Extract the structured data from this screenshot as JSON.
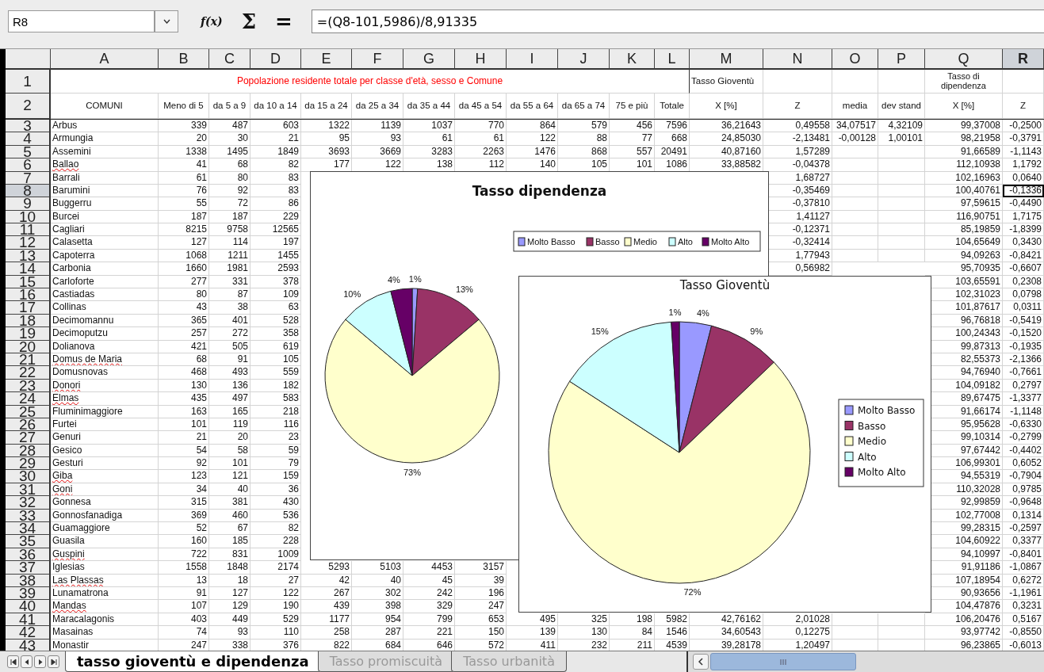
{
  "toolbar": {
    "cell_ref": "R8",
    "buttons": [
      "f(x)",
      "Σ",
      "="
    ],
    "formula": "=(Q8-101,5986)/8,91335"
  },
  "columns": [
    {
      "label": "A",
      "selected": false
    },
    {
      "label": "B",
      "selected": false
    },
    {
      "label": "C",
      "selected": false
    },
    {
      "label": "D",
      "selected": false
    },
    {
      "label": "E",
      "selected": false
    },
    {
      "label": "F",
      "selected": false
    },
    {
      "label": "G",
      "selected": false
    },
    {
      "label": "H",
      "selected": false
    },
    {
      "label": "I",
      "selected": false
    },
    {
      "label": "J",
      "selected": false
    },
    {
      "label": "K",
      "selected": false
    },
    {
      "label": "L",
      "selected": false
    },
    {
      "label": "M",
      "selected": false
    },
    {
      "label": "N",
      "selected": false
    },
    {
      "label": "O",
      "selected": false
    },
    {
      "label": "P",
      "selected": false
    },
    {
      "label": "Q",
      "selected": false
    },
    {
      "label": "R",
      "selected": true
    }
  ],
  "rows": [
    {
      "n": "1",
      "kind": "title",
      "selected": false,
      "flagged": false,
      "cells": [
        "Popolazione residente totale per classe d'età, sesso e Comune",
        "Tasso Gioventù",
        null,
        null,
        null,
        "Tasso di dipendenza",
        null
      ]
    },
    {
      "n": "2",
      "kind": "header",
      "selected": false,
      "flagged": false,
      "cells": [
        "COMUNI",
        "Meno di 5",
        "da 5 a 9",
        "da 10 a 14",
        "da 15 a 24",
        "da 25 a 34",
        "da 35 a 44",
        "da 45 a 54",
        "da 55 a 64",
        "da 65 a 74",
        "75 e più",
        "Totale",
        "X [%]",
        "Z",
        "media",
        "dev stand",
        "X [%]",
        "Z"
      ]
    },
    {
      "n": "3",
      "kind": "data",
      "selected": false,
      "flagged": false,
      "cells": [
        "Arbus",
        "339",
        "487",
        "603",
        "1322",
        "1139",
        "1037",
        "770",
        "864",
        "579",
        "456",
        "7596",
        "36,21643",
        "0,49558",
        "34,07517",
        "4,32109",
        "99,37008",
        "-0,2500"
      ]
    },
    {
      "n": "4",
      "kind": "data",
      "selected": false,
      "flagged": false,
      "cells": [
        "Armungia",
        "20",
        "30",
        "21",
        "95",
        "93",
        "61",
        "61",
        "122",
        "88",
        "77",
        "668",
        "24,85030",
        "-2,13481",
        "-0,00128",
        "1,00101",
        "98,21958",
        "-0,3791"
      ]
    },
    {
      "n": "5",
      "kind": "data",
      "selected": false,
      "flagged": false,
      "cells": [
        "Assemini",
        "1338",
        "1495",
        "1849",
        "3693",
        "3669",
        "3283",
        "2263",
        "1476",
        "868",
        "557",
        "20491",
        "40,87160",
        "1,57289",
        null,
        null,
        "91,66589",
        "-1,1143"
      ]
    },
    {
      "n": "6",
      "kind": "data",
      "selected": false,
      "flagged": true,
      "cells": [
        "Ballao",
        "41",
        "68",
        "82",
        "177",
        "122",
        "138",
        "112",
        "140",
        "105",
        "101",
        "1086",
        "33,88582",
        "-0,04378",
        null,
        null,
        "112,10938",
        "1,1792"
      ]
    },
    {
      "n": "7",
      "kind": "data",
      "selected": false,
      "flagged": false,
      "cells": [
        "Barrali",
        "61",
        "80",
        "83",
        null,
        null,
        null,
        null,
        null,
        null,
        null,
        null,
        null,
        "1,68727",
        null,
        null,
        "102,16963",
        "0,0640"
      ]
    },
    {
      "n": "8",
      "kind": "data",
      "selected": true,
      "flagged": false,
      "cells": [
        "Barumini",
        "76",
        "92",
        "83",
        null,
        null,
        null,
        null,
        null,
        null,
        null,
        null,
        null,
        "-0,35469",
        null,
        null,
        "100,40761",
        "-0,1336"
      ]
    },
    {
      "n": "9",
      "kind": "data",
      "selected": false,
      "flagged": false,
      "cells": [
        "Buggerru",
        "55",
        "72",
        "86",
        null,
        null,
        null,
        null,
        null,
        null,
        null,
        null,
        null,
        "-0,37810",
        null,
        null,
        "97,59615",
        "-0,4490"
      ]
    },
    {
      "n": "10",
      "kind": "data",
      "selected": false,
      "flagged": false,
      "cells": [
        "Burcei",
        "187",
        "187",
        "229",
        null,
        null,
        null,
        null,
        null,
        null,
        null,
        null,
        null,
        "1,41127",
        null,
        null,
        "116,90751",
        "1,7175"
      ]
    },
    {
      "n": "11",
      "kind": "data",
      "selected": false,
      "flagged": false,
      "cells": [
        "Cagliari",
        "8215",
        "9758",
        "12565",
        null,
        null,
        null,
        null,
        null,
        null,
        null,
        null,
        null,
        "-0,12371",
        null,
        null,
        "85,19859",
        "-1,8399"
      ]
    },
    {
      "n": "12",
      "kind": "data",
      "selected": false,
      "flagged": false,
      "cells": [
        "Calasetta",
        "127",
        "114",
        "197",
        null,
        null,
        null,
        null,
        null,
        null,
        null,
        null,
        null,
        "-0,32414",
        null,
        null,
        "104,65649",
        "0,3430"
      ]
    },
    {
      "n": "13",
      "kind": "data",
      "selected": false,
      "flagged": false,
      "cells": [
        "Capoterra",
        "1068",
        "1211",
        "1455",
        null,
        null,
        null,
        null,
        null,
        null,
        null,
        null,
        null,
        "1,77943",
        null,
        null,
        "94,09263",
        "-0,8421"
      ]
    },
    {
      "n": "14",
      "kind": "data",
      "selected": false,
      "flagged": false,
      "cells": [
        "Carbonia",
        "1660",
        "1981",
        "2593",
        null,
        null,
        null,
        null,
        null,
        null,
        null,
        null,
        null,
        "0,56982",
        null,
        null,
        "95,70935",
        "-0,6607"
      ]
    },
    {
      "n": "15",
      "kind": "data",
      "selected": false,
      "flagged": false,
      "cells": [
        "Carloforte",
        "277",
        "331",
        "378",
        null,
        null,
        null,
        null,
        null,
        null,
        null,
        null,
        null,
        null,
        null,
        null,
        "103,65591",
        "0,2308"
      ]
    },
    {
      "n": "16",
      "kind": "data",
      "selected": false,
      "flagged": false,
      "cells": [
        "Castiadas",
        "80",
        "87",
        "109",
        null,
        null,
        null,
        null,
        null,
        null,
        null,
        null,
        null,
        null,
        null,
        null,
        "102,31023",
        "0,0798"
      ]
    },
    {
      "n": "17",
      "kind": "data",
      "selected": false,
      "flagged": false,
      "cells": [
        "Collinas",
        "43",
        "38",
        "63",
        null,
        null,
        null,
        null,
        null,
        null,
        null,
        null,
        null,
        null,
        null,
        null,
        "101,87617",
        "0,0311"
      ]
    },
    {
      "n": "18",
      "kind": "data",
      "selected": false,
      "flagged": false,
      "cells": [
        "Decimomannu",
        "365",
        "401",
        "528",
        null,
        null,
        null,
        null,
        null,
        null,
        null,
        null,
        null,
        null,
        null,
        null,
        "96,76818",
        "-0,5419"
      ]
    },
    {
      "n": "19",
      "kind": "data",
      "selected": false,
      "flagged": false,
      "cells": [
        "Decimoputzu",
        "257",
        "272",
        "358",
        null,
        null,
        null,
        null,
        null,
        null,
        null,
        null,
        null,
        null,
        null,
        null,
        "100,24343",
        "-0,1520"
      ]
    },
    {
      "n": "20",
      "kind": "data",
      "selected": false,
      "flagged": false,
      "cells": [
        "Dolianova",
        "421",
        "505",
        "619",
        null,
        null,
        null,
        null,
        null,
        null,
        null,
        null,
        null,
        null,
        null,
        null,
        "99,87313",
        "-0,1935"
      ]
    },
    {
      "n": "21",
      "kind": "data",
      "selected": false,
      "flagged": true,
      "cells": [
        "Domus de Maria",
        "68",
        "91",
        "105",
        null,
        null,
        null,
        null,
        null,
        null,
        null,
        null,
        null,
        null,
        null,
        null,
        "82,55373",
        "-2,1366"
      ]
    },
    {
      "n": "22",
      "kind": "data",
      "selected": false,
      "flagged": false,
      "cells": [
        "Domusnovas",
        "468",
        "493",
        "559",
        null,
        null,
        null,
        null,
        null,
        null,
        null,
        null,
        null,
        null,
        null,
        null,
        "94,76940",
        "-0,7661"
      ]
    },
    {
      "n": "23",
      "kind": "data",
      "selected": false,
      "flagged": true,
      "cells": [
        "Donori",
        "130",
        "136",
        "182",
        null,
        null,
        null,
        null,
        null,
        null,
        null,
        null,
        null,
        null,
        null,
        null,
        "104,09182",
        "0,2797"
      ]
    },
    {
      "n": "24",
      "kind": "data",
      "selected": false,
      "flagged": true,
      "cells": [
        "Elmas",
        "435",
        "497",
        "583",
        null,
        null,
        null,
        null,
        null,
        null,
        null,
        null,
        null,
        null,
        null,
        null,
        "89,67475",
        "-1,3377"
      ]
    },
    {
      "n": "25",
      "kind": "data",
      "selected": false,
      "flagged": false,
      "cells": [
        "Fluminimaggiore",
        "163",
        "165",
        "218",
        null,
        null,
        null,
        null,
        null,
        null,
        null,
        null,
        null,
        null,
        null,
        null,
        "91,66174",
        "-1,1148"
      ]
    },
    {
      "n": "26",
      "kind": "data",
      "selected": false,
      "flagged": false,
      "cells": [
        "Furtei",
        "101",
        "119",
        "116",
        null,
        null,
        null,
        null,
        null,
        null,
        null,
        null,
        null,
        null,
        null,
        null,
        "95,95628",
        "-0,6330"
      ]
    },
    {
      "n": "27",
      "kind": "data",
      "selected": false,
      "flagged": false,
      "cells": [
        "Genuri",
        "21",
        "20",
        "23",
        null,
        null,
        null,
        null,
        null,
        null,
        null,
        null,
        null,
        null,
        null,
        null,
        "99,10314",
        "-0,2799"
      ]
    },
    {
      "n": "28",
      "kind": "data",
      "selected": false,
      "flagged": false,
      "cells": [
        "Gesico",
        "54",
        "58",
        "59",
        null,
        null,
        null,
        null,
        null,
        null,
        null,
        null,
        null,
        null,
        null,
        null,
        "97,67442",
        "-0,4402"
      ]
    },
    {
      "n": "29",
      "kind": "data",
      "selected": false,
      "flagged": false,
      "cells": [
        "Gesturi",
        "92",
        "101",
        "79",
        null,
        null,
        null,
        null,
        null,
        null,
        null,
        null,
        null,
        null,
        null,
        null,
        "106,99301",
        "0,6052"
      ]
    },
    {
      "n": "30",
      "kind": "data",
      "selected": false,
      "flagged": true,
      "cells": [
        "Giba",
        "123",
        "121",
        "159",
        null,
        null,
        null,
        null,
        null,
        null,
        null,
        null,
        null,
        null,
        null,
        null,
        "94,55319",
        "-0,7904"
      ]
    },
    {
      "n": "31",
      "kind": "data",
      "selected": false,
      "flagged": true,
      "cells": [
        "Goni",
        "34",
        "40",
        "36",
        null,
        null,
        null,
        null,
        null,
        null,
        null,
        null,
        null,
        null,
        null,
        null,
        "110,32028",
        "0,9785"
      ]
    },
    {
      "n": "32",
      "kind": "data",
      "selected": false,
      "flagged": false,
      "cells": [
        "Gonnesa",
        "315",
        "381",
        "430",
        null,
        null,
        null,
        null,
        null,
        null,
        null,
        null,
        null,
        null,
        null,
        null,
        "92,99859",
        "-0,9648"
      ]
    },
    {
      "n": "33",
      "kind": "data",
      "selected": false,
      "flagged": false,
      "cells": [
        "Gonnosfanadiga",
        "369",
        "460",
        "536",
        null,
        null,
        null,
        null,
        null,
        null,
        null,
        null,
        null,
        null,
        null,
        null,
        "102,77008",
        "0,1314"
      ]
    },
    {
      "n": "34",
      "kind": "data",
      "selected": false,
      "flagged": false,
      "cells": [
        "Guamaggiore",
        "52",
        "67",
        "82",
        null,
        null,
        null,
        null,
        null,
        null,
        null,
        null,
        null,
        null,
        null,
        null,
        "99,28315",
        "-0,2597"
      ]
    },
    {
      "n": "35",
      "kind": "data",
      "selected": false,
      "flagged": false,
      "cells": [
        "Guasila",
        "160",
        "185",
        "228",
        null,
        null,
        null,
        null,
        null,
        null,
        null,
        null,
        null,
        null,
        null,
        null,
        "104,60922",
        "0,3377"
      ]
    },
    {
      "n": "36",
      "kind": "data",
      "selected": false,
      "flagged": true,
      "cells": [
        "Guspini",
        "722",
        "831",
        "1009",
        null,
        null,
        null,
        null,
        null,
        null,
        null,
        null,
        null,
        null,
        null,
        null,
        "94,10997",
        "-0,8401"
      ]
    },
    {
      "n": "37",
      "kind": "data",
      "selected": false,
      "flagged": false,
      "cells": [
        "Iglesias",
        "1558",
        "1848",
        "2174",
        "5293",
        "5103",
        "4453",
        "3157",
        null,
        null,
        null,
        null,
        null,
        null,
        null,
        null,
        "91,91186",
        "-1,0867"
      ]
    },
    {
      "n": "38",
      "kind": "data",
      "selected": false,
      "flagged": true,
      "cells": [
        "Las Plassas",
        "13",
        "18",
        "27",
        "42",
        "40",
        "45",
        "39",
        null,
        null,
        null,
        null,
        null,
        null,
        null,
        null,
        "107,18954",
        "0,6272"
      ]
    },
    {
      "n": "39",
      "kind": "data",
      "selected": false,
      "flagged": false,
      "cells": [
        "Lunamatrona",
        "91",
        "127",
        "122",
        "267",
        "302",
        "242",
        "196",
        null,
        null,
        null,
        null,
        null,
        null,
        null,
        null,
        "90,93656",
        "-1,1961"
      ]
    },
    {
      "n": "40",
      "kind": "data",
      "selected": false,
      "flagged": true,
      "cells": [
        "Mandas",
        "107",
        "129",
        "190",
        "439",
        "398",
        "329",
        "247",
        null,
        null,
        null,
        null,
        null,
        null,
        null,
        null,
        "104,47876",
        "0,3231"
      ]
    },
    {
      "n": "41",
      "kind": "data",
      "selected": false,
      "flagged": false,
      "cells": [
        "Maracalagonis",
        "403",
        "449",
        "529",
        "1177",
        "954",
        "799",
        "653",
        "495",
        "325",
        "198",
        "5982",
        "42,76162",
        "2,01028",
        null,
        null,
        "106,20476",
        "0,5167"
      ]
    },
    {
      "n": "42",
      "kind": "data",
      "selected": false,
      "flagged": false,
      "cells": [
        "Masainas",
        "74",
        "93",
        "110",
        "258",
        "287",
        "221",
        "150",
        "139",
        "130",
        "84",
        "1546",
        "34,60543",
        "0,12275",
        null,
        null,
        "93,97742",
        "-0,8550"
      ]
    },
    {
      "n": "43",
      "kind": "data",
      "selected": false,
      "flagged": false,
      "cells": [
        "Monastir",
        "247",
        "338",
        "376",
        "822",
        "684",
        "646",
        "572",
        "411",
        "232",
        "211",
        "4539",
        "39,28178",
        "1,20497",
        null,
        null,
        "96,23865",
        "-0,6013"
      ]
    }
  ],
  "charts": [
    {
      "chart_data": {
        "type": "pie",
        "title": "Tasso dipendenza",
        "legend": "top",
        "categories": [
          "Molto Basso",
          "Basso",
          "Medio",
          "Alto",
          "Molto Alto"
        ],
        "colors": [
          "#9999ff",
          "#993366",
          "#ffffcc",
          "#ccffff",
          "#660066"
        ],
        "values": [
          1,
          13,
          73,
          10,
          4
        ],
        "value_labels": [
          "1%",
          "13%",
          "73%",
          "10%",
          "4%"
        ]
      }
    },
    {
      "chart_data": {
        "type": "pie",
        "title": "Tasso Gioventù",
        "legend": "right",
        "categories": [
          "Molto Basso",
          "Basso",
          "Medio",
          "Alto",
          "Molto Alto"
        ],
        "colors": [
          "#9999ff",
          "#993366",
          "#ffffcc",
          "#ccffff",
          "#660066"
        ],
        "values": [
          4,
          9,
          72,
          15,
          1
        ],
        "value_labels": [
          "4%",
          "9%",
          "72%",
          "15%",
          "1%"
        ]
      }
    }
  ],
  "sheet_tabs": [
    {
      "label": "tasso gioventù e dipendenza",
      "selected": true
    },
    {
      "label": "Tasso promiscuità",
      "selected": false
    },
    {
      "label": "Tasso urbanità",
      "selected": false
    }
  ]
}
